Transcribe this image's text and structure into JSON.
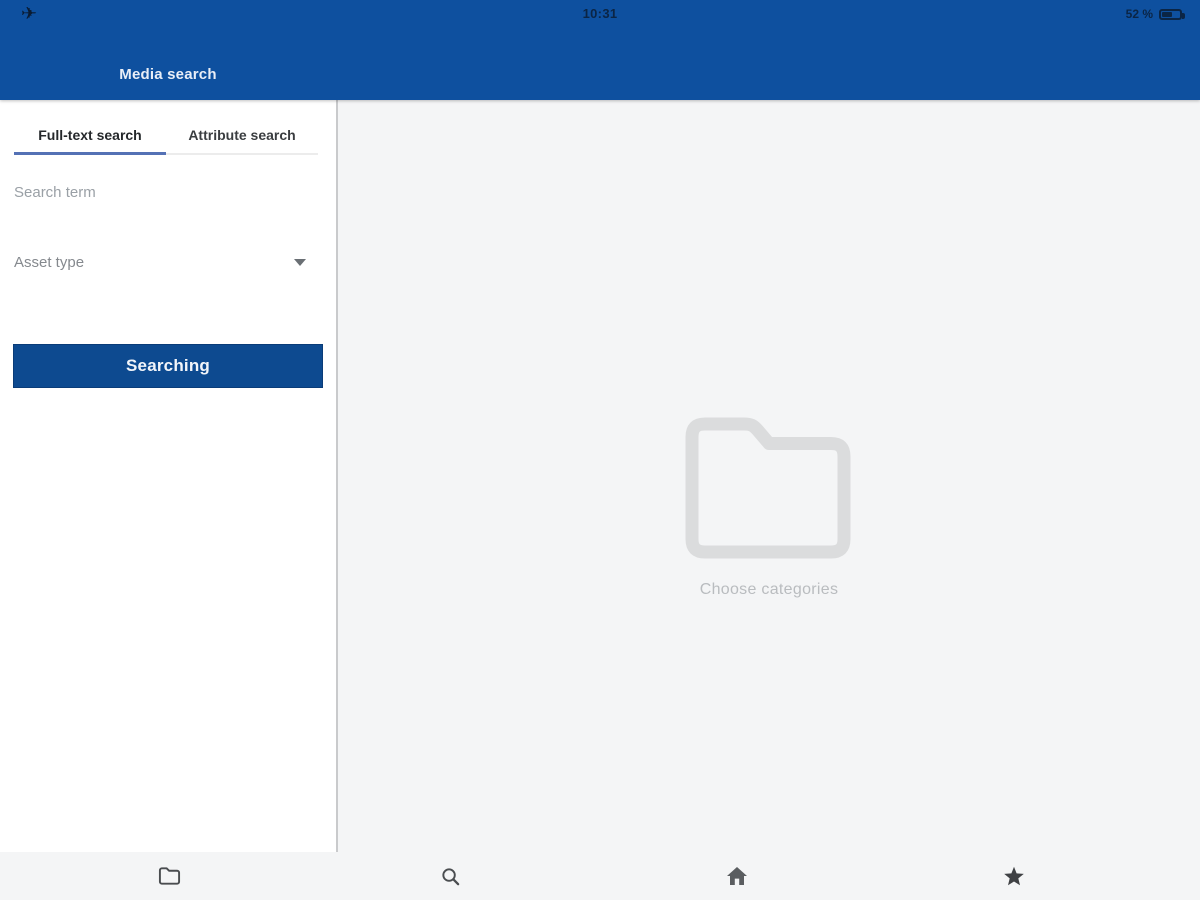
{
  "status_bar": {
    "airplane_icon": "airplane-mode-indicator",
    "time": "10:31",
    "battery_label": "52 %",
    "battery_level_percent": 52
  },
  "header": {
    "title": "Media search"
  },
  "sidebar": {
    "tabs": [
      {
        "label": "Full-text search",
        "active": true
      },
      {
        "label": "Attribute search",
        "active": false
      }
    ],
    "fields": {
      "search_term_placeholder": "Search term",
      "asset_type_label": "Asset type"
    },
    "search_button_label": "Searching"
  },
  "main": {
    "empty_state": {
      "icon": "folder-icon",
      "label": "Choose categories"
    }
  },
  "bottom_nav": {
    "items": [
      {
        "icon": "folder-icon",
        "name": "categories"
      },
      {
        "icon": "search-icon",
        "name": "search"
      },
      {
        "icon": "home-icon",
        "name": "home"
      },
      {
        "icon": "star-icon",
        "name": "favorites"
      }
    ]
  },
  "colors": {
    "header_blue": "#0e509f",
    "button_blue": "#0d4a90",
    "tab_indicator_blue": "#5471b5",
    "status_text": "#0b2545",
    "sidebar_bg": "#ffffff",
    "main_bg": "#f4f5f6",
    "placeholder_gray": "#9aa0a6",
    "empty_state_gray": "#dbdcdd",
    "nav_icon_gray": "#4a4d50"
  }
}
